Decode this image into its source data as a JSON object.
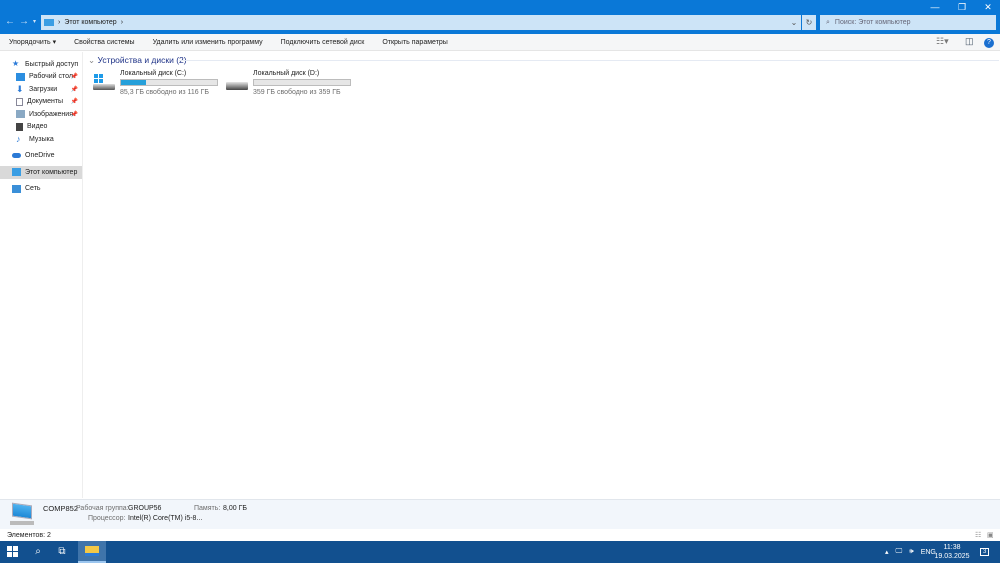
{
  "window": {
    "minimize": "—",
    "maximize": "❐",
    "close": "✕"
  },
  "address": {
    "path": "Этот компьютер",
    "separator": "›",
    "search_placeholder": "Поиск: Этот компьютер"
  },
  "toolbar": {
    "organize": "Упорядочить ▾",
    "system_properties": "Свойства системы",
    "uninstall": "Удалить или изменить программу",
    "map_drive": "Подключить сетевой диск",
    "open_settings": "Открыть параметры"
  },
  "sidebar": {
    "items": [
      {
        "label": "Быстрый доступ",
        "icon": "star-icon",
        "pinned": false
      },
      {
        "label": "Рабочий стол",
        "icon": "desktop-icon",
        "pinned": true
      },
      {
        "label": "Загрузки",
        "icon": "download-icon",
        "pinned": true
      },
      {
        "label": "Документы",
        "icon": "documents-icon",
        "pinned": true
      },
      {
        "label": "Изображения",
        "icon": "pictures-icon",
        "pinned": true
      },
      {
        "label": "Видео",
        "icon": "video-icon",
        "pinned": false
      },
      {
        "label": "Музыка",
        "icon": "music-icon",
        "pinned": false
      },
      {
        "label": "OneDrive",
        "icon": "cloud-icon",
        "pinned": false
      },
      {
        "label": "Этот компьютер",
        "icon": "computer-icon",
        "pinned": false,
        "selected": true
      },
      {
        "label": "Сеть",
        "icon": "network-icon",
        "pinned": false
      }
    ]
  },
  "group": {
    "title": "Устройства и диски (2)"
  },
  "drives": [
    {
      "name": "Локальный диск (C:)",
      "free": "85,3 ГБ свободно из 116 ГБ",
      "used_percent": 26
    },
    {
      "name": "Локальный диск (D:)",
      "free": "359 ГБ свободно из 359 ГБ",
      "used_percent": 0
    }
  ],
  "details": {
    "computer": "COMP852",
    "workgroup_label": "Рабочая группа:",
    "workgroup": "GROUP56",
    "memory_label": "Память:",
    "memory": "8,00 ГБ",
    "cpu_label": "Процессор:",
    "cpu": "Intel(R) Core(TM) i5-8..."
  },
  "status": {
    "items": "Элементов: 2"
  },
  "tray": {
    "lang": "ENG",
    "time": "11:38",
    "date": "19.03.2025",
    "notifications": "3"
  },
  "colors": {
    "accent": "#0a78d7",
    "taskbar": "#12508f",
    "progress": "#26a0da"
  }
}
